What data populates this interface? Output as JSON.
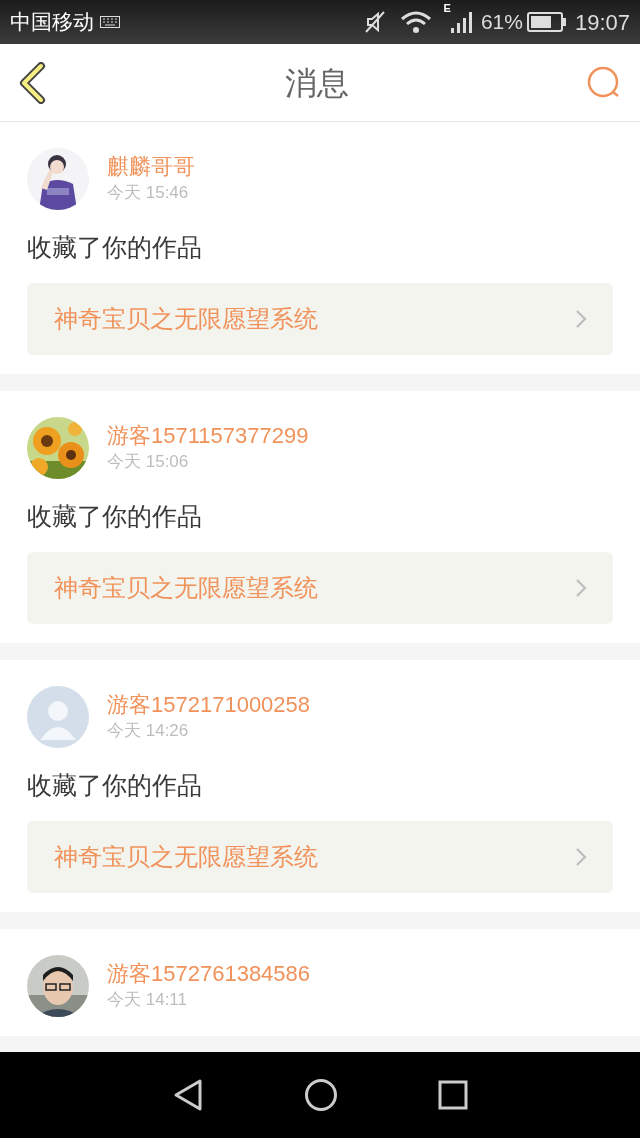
{
  "status_bar": {
    "carrier": "中国移动",
    "network_type": "E",
    "battery": "61%",
    "time": "19:07"
  },
  "header": {
    "title": "消息"
  },
  "messages": [
    {
      "user": "麒麟哥哥",
      "time": "今天 15:46",
      "action": "收藏了你的作品",
      "work": "神奇宝贝之无限愿望系统"
    },
    {
      "user": "游客1571157377299",
      "time": "今天 15:06",
      "action": "收藏了你的作品",
      "work": "神奇宝贝之无限愿望系统"
    },
    {
      "user": "游客1572171000258",
      "avatar": {
        "kind": "default"
      },
      "time": "今天 14:26",
      "action": "收藏了你的作品",
      "work": "神奇宝贝之无限愿望系统"
    },
    {
      "user": "游客1572761384586",
      "time": "今天 14:11"
    }
  ]
}
